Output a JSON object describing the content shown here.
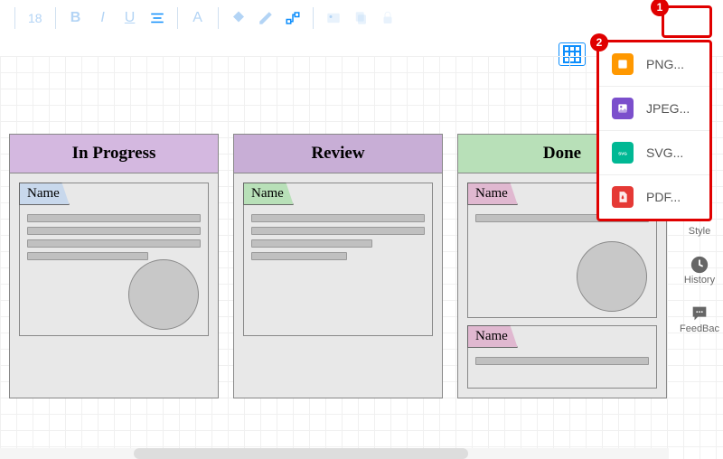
{
  "toolbar": {
    "fontsize": "18"
  },
  "annotations": {
    "badge1": "1",
    "badge2": "2"
  },
  "export_menu": [
    {
      "label": "PNG...",
      "icon": "png"
    },
    {
      "label": "JPEG...",
      "icon": "jpeg"
    },
    {
      "label": "SVG...",
      "icon": "svg"
    },
    {
      "label": "PDF...",
      "icon": "pdf"
    }
  ],
  "columns": [
    {
      "title": "In Progress",
      "header_class": "hdr-purple",
      "cards": [
        {
          "name": "Name",
          "tab": "tab-blue",
          "lines": 4,
          "circle": true
        }
      ]
    },
    {
      "title": "Review",
      "header_class": "hdr-purple2",
      "cards": [
        {
          "name": "Name",
          "tab": "tab-green",
          "lines": 4,
          "circle": false
        }
      ]
    },
    {
      "title": "Done",
      "header_class": "hdr-green",
      "cards": [
        {
          "name": "Name",
          "tab": "tab-pink",
          "lines": 1,
          "circle": true
        },
        {
          "name": "Name",
          "tab": "tab-pink",
          "lines": 1,
          "circle": false,
          "small": true
        }
      ]
    }
  ],
  "sidebar": [
    {
      "label": "Style"
    },
    {
      "label": "History"
    },
    {
      "label": "FeedBac"
    }
  ]
}
